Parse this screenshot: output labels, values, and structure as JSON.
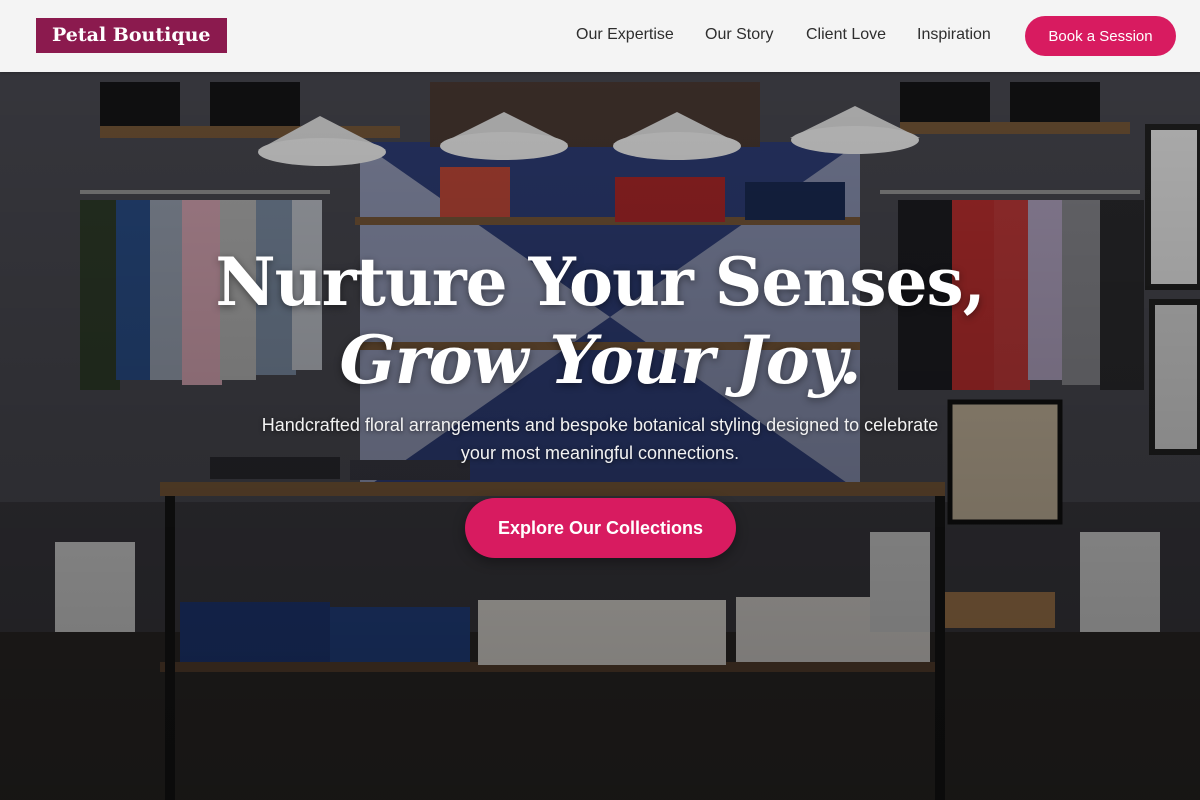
{
  "brand": {
    "name": "Petal Boutique",
    "color": "#8b1a4e"
  },
  "nav": {
    "links": [
      "Our Expertise",
      "Our Story",
      "Client Love",
      "Inspiration"
    ],
    "cta_label": "Book a Session"
  },
  "hero": {
    "headline_line1": "Nurture Your Senses,",
    "headline_line2": "Grow Your Joy.",
    "subtext": "Handcrafted floral arrangements and bespoke botanical styling designed to celebrate your most meaningful connections.",
    "cta_label": "Explore Our Collections",
    "image_description": "boutique-store-interior-photo"
  },
  "colors": {
    "accent": "#d81b60",
    "header_bg": "#f4f4f4",
    "nav_text": "#2e2e2e"
  }
}
